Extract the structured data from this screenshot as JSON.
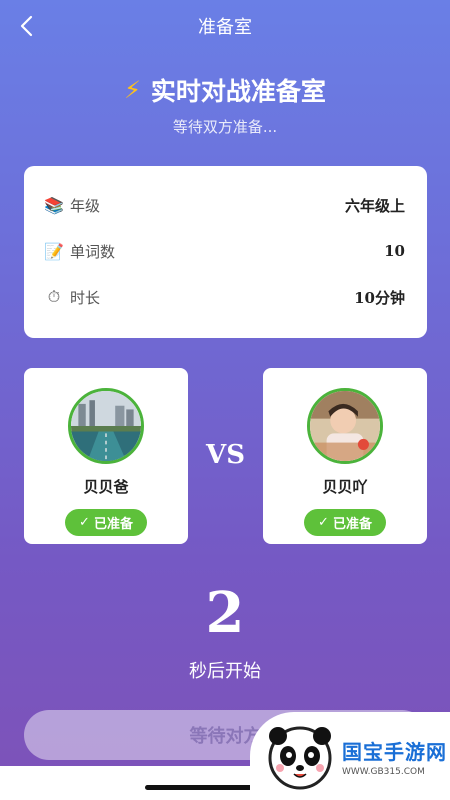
{
  "nav": {
    "title": "准备室",
    "back_icon": "chevron-left-icon"
  },
  "hero": {
    "title": "实时对战准备室",
    "icon": "lightning-icon",
    "subtitle": "等待双方准备..."
  },
  "info": {
    "rows": [
      {
        "label": "年级",
        "value": "六年级上",
        "icon": "books-icon"
      },
      {
        "label": "单词数",
        "value": "10",
        "icon": "memo-icon"
      },
      {
        "label": "时长",
        "value": "10分钟",
        "icon": "stopwatch-icon"
      }
    ]
  },
  "players": {
    "left": {
      "name": "贝贝爸",
      "status": "已准备"
    },
    "right": {
      "name": "贝贝吖",
      "status": "已准备"
    },
    "vs": "VS"
  },
  "countdown": {
    "value": "2",
    "label": "秒后开始"
  },
  "action": {
    "label": "等待对方"
  },
  "watermark": {
    "text": "国宝手游网",
    "url": "WWW.GB315.COM"
  },
  "colors": {
    "accent_green": "#5ec13a",
    "bg_top": "#6a7fe6",
    "bg_bottom": "#7e52b8"
  }
}
